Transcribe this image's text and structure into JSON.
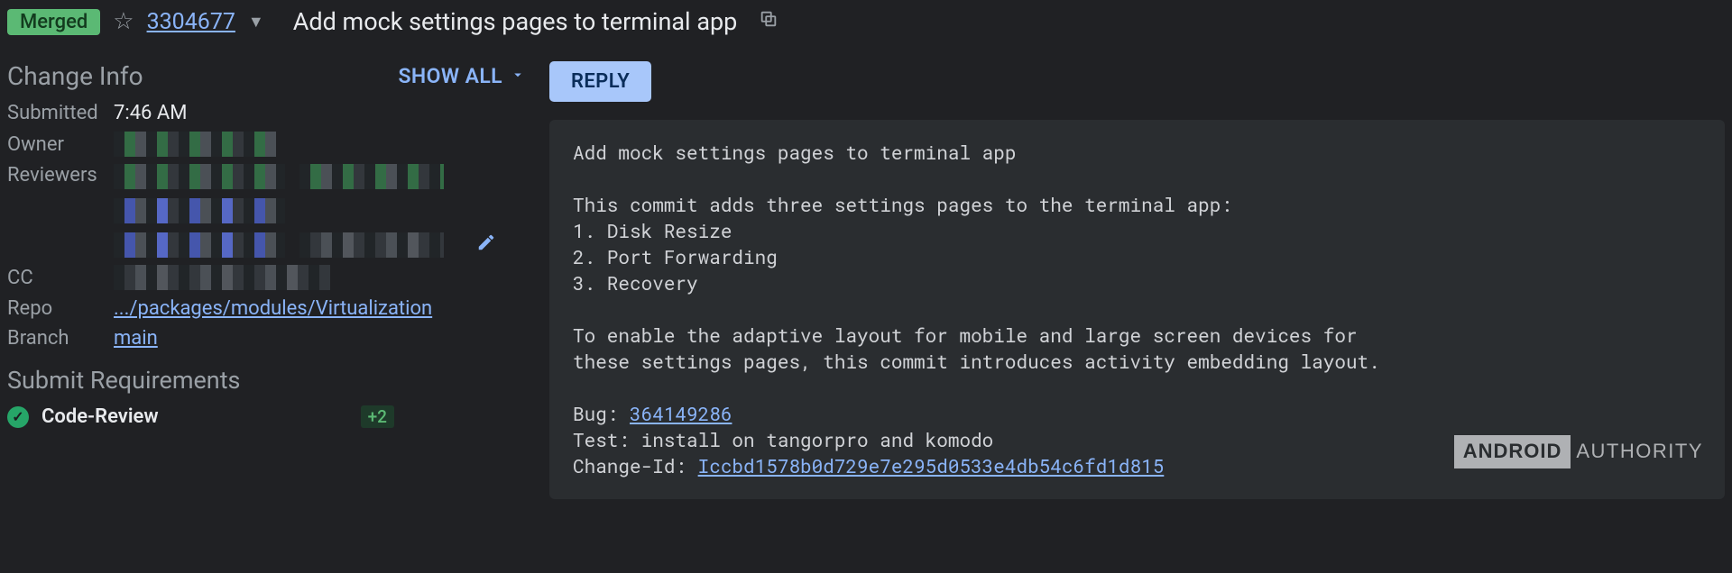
{
  "header": {
    "status": "Merged",
    "change_number": "3304677",
    "title": "Add mock settings pages to terminal app"
  },
  "actions": {
    "show_all": "SHOW ALL",
    "reply": "REPLY"
  },
  "info": {
    "heading": "Change Info",
    "submitted_label": "Submitted",
    "submitted_time": "7:46 AM",
    "owner_label": "Owner",
    "reviewers_label": "Reviewers",
    "cc_label": "CC",
    "repo_label": "Repo",
    "repo_path": ".../packages/modules/Virtualization",
    "branch_label": "Branch",
    "branch": "main"
  },
  "submit": {
    "heading": "Submit Requirements",
    "req_name": "Code-Review",
    "req_score": "+2"
  },
  "commit": {
    "title": "Add mock settings pages to terminal app",
    "body": "This commit adds three settings pages to the terminal app:\n1. Disk Resize\n2. Port Forwarding\n3. Recovery\n\nTo enable the adaptive layout for mobile and large screen devices for\nthese settings pages, this commit introduces activity embedding layout.",
    "bug_label": "Bug: ",
    "bug_id": "364149286",
    "test_line": "Test: install on tangorpro and komodo",
    "changeid_label": "Change-Id: ",
    "changeid": "Iccbd1578b0d729e7e295d0533e4db54c6fd1d815"
  },
  "watermark": {
    "brand1": "ANDROID",
    "brand2": "AUTHORITY"
  }
}
